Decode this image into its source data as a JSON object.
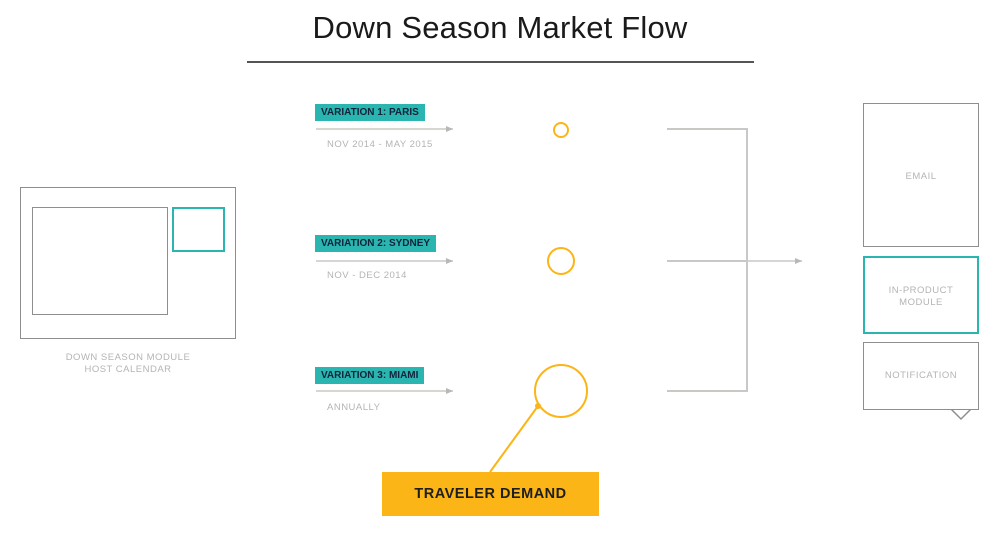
{
  "title": "Down Season Market Flow",
  "calendar": {
    "caption_line1": "DOWN SEASON MODULE",
    "caption_line2": "HOST CALENDAR"
  },
  "variations": [
    {
      "label": "VARIATION 1: PARIS",
      "dates": "NOV 2014 - MAY 2015"
    },
    {
      "label": "VARIATION 2: SYDNEY",
      "dates": "NOV - DEC 2014"
    },
    {
      "label": "VARIATION 3: MIAMI",
      "dates": "ANNUALLY"
    }
  ],
  "outputs": {
    "email": "EMAIL",
    "in_product_line1": "IN-PRODUCT",
    "in_product_line2": "MODULE",
    "notification": "NOTIFICATION"
  },
  "demand_label": "TRAVELER DEMAND",
  "colors": {
    "teal": "#2ab5b0",
    "yellow": "#fbb516",
    "gray_line": "#c8c8c4"
  }
}
